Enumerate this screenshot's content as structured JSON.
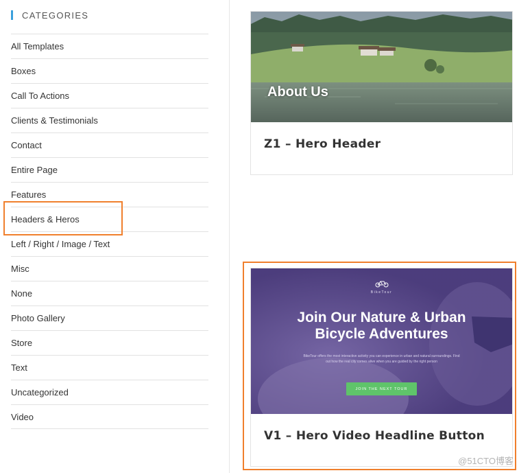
{
  "sidebar": {
    "title": "CATEGORIES",
    "items": [
      {
        "label": "All Templates"
      },
      {
        "label": "Boxes"
      },
      {
        "label": "Call To Actions"
      },
      {
        "label": "Clients & Testimonials"
      },
      {
        "label": "Contact"
      },
      {
        "label": "Entire Page"
      },
      {
        "label": "Features"
      },
      {
        "label": "Headers & Heros"
      },
      {
        "label": "Left / Right / Image / Text"
      },
      {
        "label": "Misc"
      },
      {
        "label": "None"
      },
      {
        "label": "Photo Gallery"
      },
      {
        "label": "Store"
      },
      {
        "label": "Text"
      },
      {
        "label": "Uncategorized"
      },
      {
        "label": "Video"
      }
    ]
  },
  "cards": [
    {
      "title": "Z1 – Hero Header",
      "thumbnail_caption": "About Us"
    },
    {
      "title": "V1 – Hero Video Headline Button",
      "thumbnail": {
        "brand": "BikeTour",
        "headline_line1": "Join Our Nature & Urban",
        "headline_line2": "Bicycle Adventures",
        "body": "BikeTour offers the most interactive activity you can experience in urban and natural surroundings. Find out how the real city comes alive when you are guided by the right person",
        "cta": "JOIN THE NEXT TOUR"
      }
    }
  ],
  "watermark": "@51CTO博客",
  "colors": {
    "accent": "#3aa0dc",
    "highlight": "#f07f2c",
    "cta_green": "#5fc46a",
    "video_overlay": "#5a4a8c"
  }
}
